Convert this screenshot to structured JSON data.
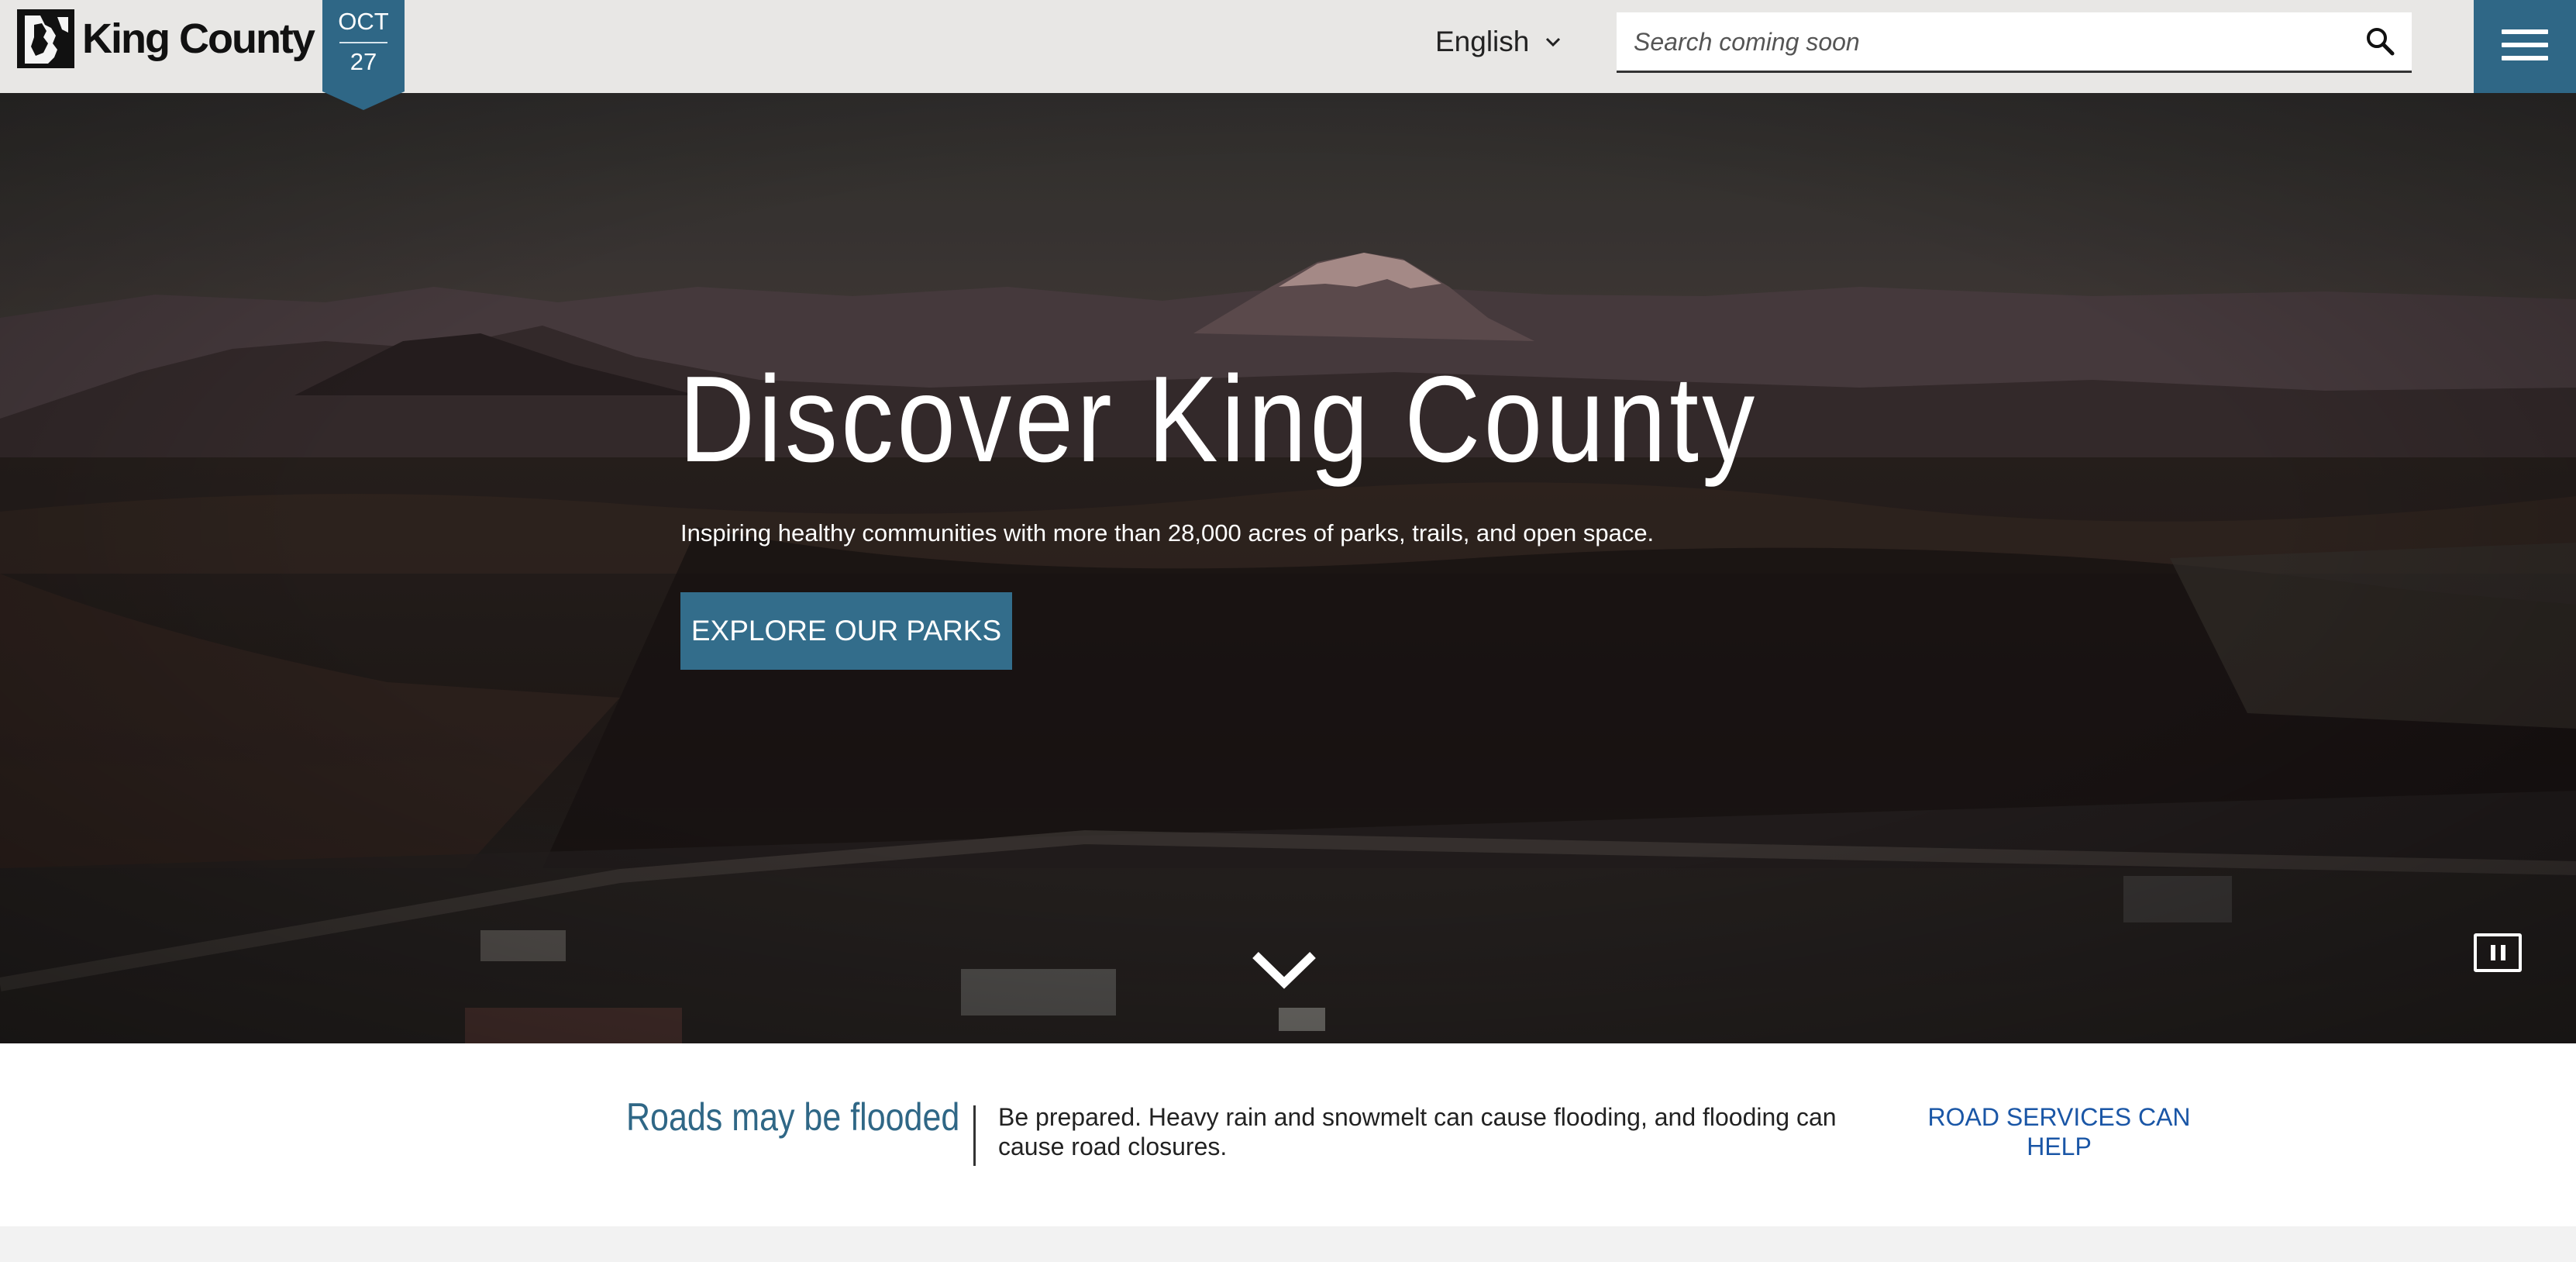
{
  "header": {
    "logo_text": "King County",
    "date": {
      "month": "OCT",
      "day": "27"
    },
    "language": {
      "selected": "English",
      "icon": "chevron-down-icon"
    },
    "search": {
      "placeholder": "Search coming soon",
      "value": "",
      "icon": "search-icon"
    },
    "menu_icon": "hamburger-menu-icon"
  },
  "hero": {
    "title": "Discover King County",
    "subtitle": "Inspiring healthy communities with more than 28,000 acres of parks, trails, and open space.",
    "cta_label": "EXPLORE OUR PARKS",
    "scroll_icon": "chevron-down-icon",
    "pause_icon": "pause-icon"
  },
  "alert": {
    "title": "Roads may be flooded",
    "text": "Be prepared. Heavy rain and snowmelt can cause flooding, and flooding can cause road closures.",
    "link_label": "ROAD SERVICES CAN HELP"
  },
  "colors": {
    "header_bg": "#e8e7e5",
    "accent": "#2f6786",
    "cta": "#336d8b",
    "link": "#1a56a6"
  }
}
